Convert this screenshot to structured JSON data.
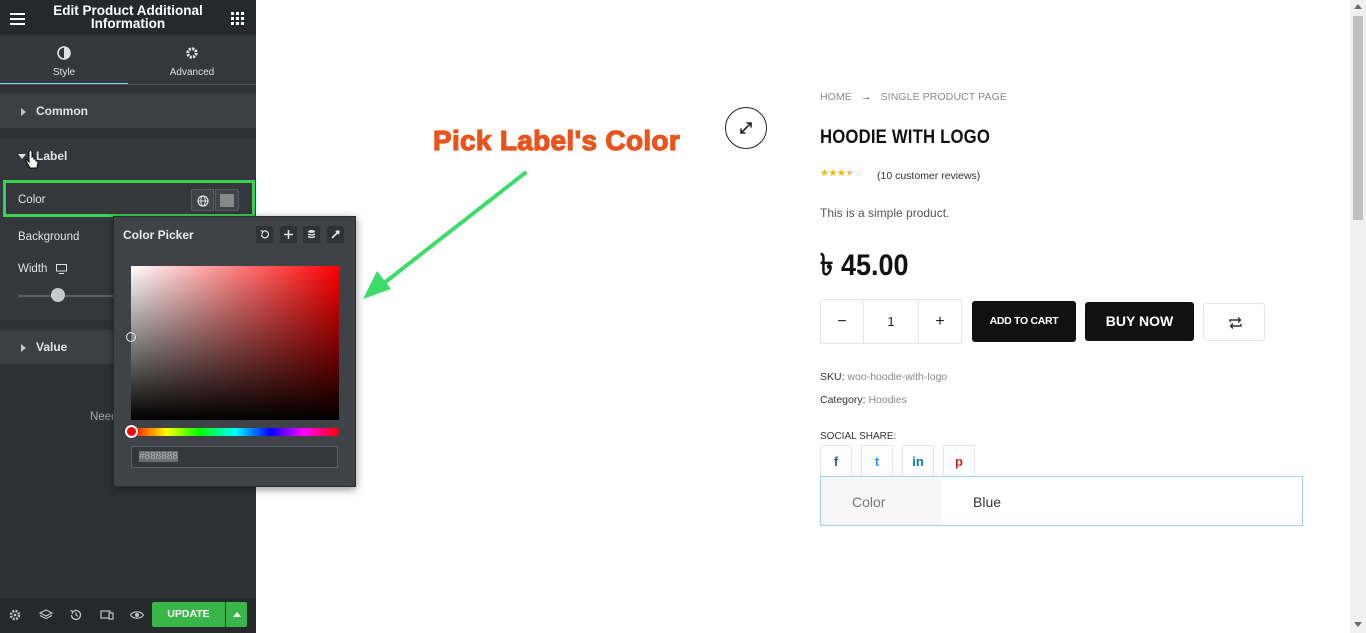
{
  "panel": {
    "title": "Edit Product Additional Information",
    "tabs": [
      {
        "label": "Style",
        "icon": "half-circle-icon",
        "active": true
      },
      {
        "label": "Advanced",
        "icon": "gear-icon",
        "active": false
      }
    ],
    "sections": {
      "common": "Common",
      "label": "Label",
      "value": "Value"
    },
    "controls": {
      "color": "Color",
      "background": "Background",
      "width": "Width",
      "need_help_partial": "Need"
    },
    "footer": {
      "update": "UPDATE"
    }
  },
  "color_picker": {
    "title": "Color Picker",
    "hex_value": "#888888",
    "tools": [
      "reset-icon",
      "plus-icon",
      "stack-icon",
      "eyedropper-icon"
    ]
  },
  "annotation": {
    "text": "Pick Label's Color",
    "arrow_color": "#3ddc6a",
    "text_color": "#e8541c"
  },
  "product": {
    "breadcrumb": [
      "HOME",
      "SINGLE PRODUCT PAGE"
    ],
    "title": "HOODIE WITH LOGO",
    "rating": 3.5,
    "reviews": "(10 customer reviews)",
    "short_description": "This is a simple product.",
    "price": "৳ 45.00",
    "quantity": "1",
    "minus": "−",
    "plus": "+",
    "add_to_cart": "ADD TO CART",
    "buy_now": "BUY NOW",
    "sku_label": "SKU:",
    "sku_value": "woo-hoodie-with-logo",
    "category_label": "Category:",
    "category_value": "Hoodies",
    "social_share": "SOCIAL SHARE:",
    "social": [
      "f",
      "t",
      "in",
      "p"
    ],
    "info_table": [
      {
        "label": "Color",
        "value": "Blue"
      }
    ]
  },
  "colors": {
    "accent_green": "#39b54a",
    "highlight_green": "#39d353",
    "tab_active": "#71d7f7"
  }
}
